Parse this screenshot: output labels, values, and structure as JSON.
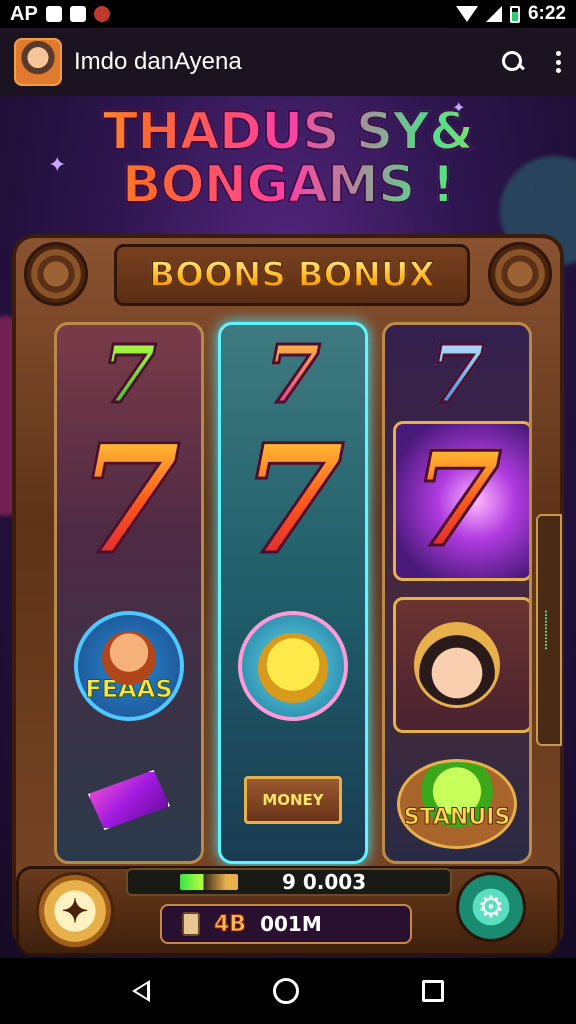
{
  "status_bar": {
    "left_text": "AP",
    "time": "6:22"
  },
  "app_bar": {
    "title": "Imdo danAyena",
    "icons": [
      "avatar",
      "search-icon",
      "more-vert-icon"
    ]
  },
  "game": {
    "title_line1": "THADUS SY&",
    "title_line2": "BONGAMS !",
    "banner": "BOONS BONUX",
    "reels": [
      {
        "symbols": [
          {
            "type": "seven",
            "text": "7",
            "color": "green"
          },
          {
            "type": "seven",
            "text": "7",
            "color": "red-orange"
          },
          {
            "type": "badge",
            "text": "FEAAS"
          },
          {
            "type": "crystal",
            "text": ""
          }
        ]
      },
      {
        "symbols": [
          {
            "type": "seven",
            "text": "7",
            "color": "pink"
          },
          {
            "type": "seven",
            "text": "7",
            "color": "red-orange"
          },
          {
            "type": "badge",
            "text": ""
          },
          {
            "type": "money",
            "text": "MONEY"
          }
        ]
      },
      {
        "symbols": [
          {
            "type": "seven",
            "text": "7",
            "color": "blue"
          },
          {
            "type": "seven",
            "text": "7",
            "color": "red-orange"
          },
          {
            "type": "portrait",
            "text": ""
          },
          {
            "type": "bonus",
            "text": "STANUIS"
          }
        ]
      }
    ],
    "side_tab_text": "............",
    "controls": {
      "top_value": "9 0.003",
      "bottom_value_1": "4B",
      "bottom_value_2": "001M",
      "spin_icon": "star-icon",
      "settings_icon": "gear-icon"
    }
  },
  "colors": {
    "reel_highlight": "#5ff4ff",
    "frame": "#7a4726",
    "gold": "#e8b04a"
  }
}
